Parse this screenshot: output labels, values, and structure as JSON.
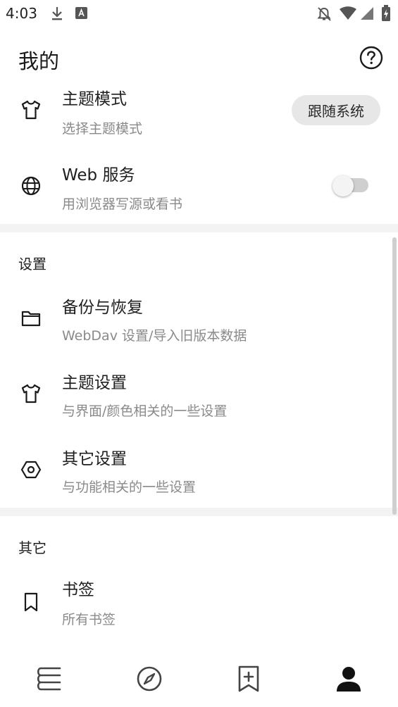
{
  "status_bar": {
    "time": "4:03",
    "icons": [
      "download-icon",
      "font-icon",
      "notifications-off-icon",
      "wifi-icon",
      "signal-icon",
      "battery-charging-icon"
    ]
  },
  "header": {
    "title": "我的",
    "help_icon": "help-circle-icon"
  },
  "top_items": [
    {
      "icon": "shirt-icon",
      "title": "主题模式",
      "subtitle": "选择主题模式",
      "control": {
        "type": "chip",
        "label": "跟随系统"
      }
    },
    {
      "icon": "globe-icon",
      "title": "Web 服务",
      "subtitle": "用浏览器写源或看书",
      "control": {
        "type": "switch",
        "state": "off"
      }
    }
  ],
  "sections": [
    {
      "header": "设置",
      "items": [
        {
          "icon": "folder-icon",
          "title": "备份与恢复",
          "subtitle": "WebDav 设置/导入旧版本数据"
        },
        {
          "icon": "shirt-icon",
          "title": "主题设置",
          "subtitle": "与界面/颜色相关的一些设置"
        },
        {
          "icon": "hexagon-settings-icon",
          "title": "其它设置",
          "subtitle": "与功能相关的一些设置"
        }
      ]
    },
    {
      "header": "其它",
      "items": [
        {
          "icon": "bookmark-icon",
          "title": "书签",
          "subtitle": "所有书签"
        }
      ]
    }
  ],
  "bottom_nav": {
    "items": [
      {
        "icon": "bookshelf-icon",
        "active": false
      },
      {
        "icon": "compass-icon",
        "active": false
      },
      {
        "icon": "bookmark-add-icon",
        "active": false
      },
      {
        "icon": "person-icon",
        "active": true
      }
    ]
  },
  "colors": {
    "background": "#ffffff",
    "divider": "#f3f3f3",
    "chip": "#e7e7e7",
    "subtitle": "#8a8a8a",
    "icon": "#1a1a1a"
  }
}
